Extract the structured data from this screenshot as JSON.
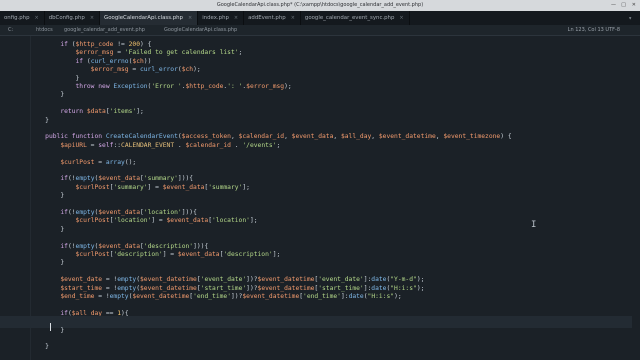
{
  "window_title": "GoogleCalendarApi.class.php* (C:\\xampp\\htdocs\\google_calendar_add_event.php)",
  "tabs": [
    {
      "label": "onfig.php",
      "active": false
    },
    {
      "label": "dbConfig.php",
      "active": false
    },
    {
      "label": "GoogleCalendarApi.class.php",
      "active": true
    },
    {
      "label": "index.php",
      "active": false
    },
    {
      "label": "addEvent.php",
      "active": false
    },
    {
      "label": "google_calendar_event_sync.php",
      "active": false
    }
  ],
  "breadcrumbs": [
    "C:",
    "htdocs",
    "google_calendar_add_event.php",
    "GoogleCalendarApi.class.php"
  ],
  "status": "Ln 123, Col 13   UTF-8",
  "code_lines": [
    [
      {
        "t": "        "
      },
      {
        "t": "if",
        "c": "kw"
      },
      {
        "t": " ("
      },
      {
        "t": "$http_code",
        "c": "var"
      },
      {
        "t": " != "
      },
      {
        "t": "200",
        "c": "num"
      },
      {
        "t": ") {"
      }
    ],
    [
      {
        "t": "            "
      },
      {
        "t": "$error_msg",
        "c": "var"
      },
      {
        "t": " = "
      },
      {
        "t": "'Failed to get calendars list'",
        "c": "str"
      },
      {
        "t": ";"
      }
    ],
    [
      {
        "t": "            "
      },
      {
        "t": "if",
        "c": "kw"
      },
      {
        "t": " ("
      },
      {
        "t": "curl_errno",
        "c": "fn"
      },
      {
        "t": "("
      },
      {
        "t": "$ch",
        "c": "var"
      },
      {
        "t": "))"
      }
    ],
    [
      {
        "t": "                "
      },
      {
        "t": "$error_msg",
        "c": "var"
      },
      {
        "t": " = "
      },
      {
        "t": "curl_error",
        "c": "fn"
      },
      {
        "t": "("
      },
      {
        "t": "$ch",
        "c": "var"
      },
      {
        "t": ");"
      }
    ],
    [
      {
        "t": "            "
      },
      {
        "t": "}"
      }
    ],
    [
      {
        "t": "            "
      },
      {
        "t": "throw new",
        "c": "kw"
      },
      {
        "t": " "
      },
      {
        "t": "Exception",
        "c": "fn"
      },
      {
        "t": "("
      },
      {
        "t": "'Error '",
        "c": "str"
      },
      {
        "t": "."
      },
      {
        "t": "$http_code",
        "c": "var"
      },
      {
        "t": "."
      },
      {
        "t": "': '",
        "c": "str"
      },
      {
        "t": "."
      },
      {
        "t": "$error_msg",
        "c": "var"
      },
      {
        "t": ");"
      }
    ],
    [
      {
        "t": "        "
      },
      {
        "t": "}"
      }
    ],
    [
      {
        "t": ""
      }
    ],
    [
      {
        "t": "        "
      },
      {
        "t": "return",
        "c": "kw"
      },
      {
        "t": " "
      },
      {
        "t": "$data",
        "c": "var"
      },
      {
        "t": "["
      },
      {
        "t": "'items'",
        "c": "str"
      },
      {
        "t": "];"
      }
    ],
    [
      {
        "t": "    "
      },
      {
        "t": "}"
      }
    ],
    [
      {
        "t": ""
      }
    ],
    [
      {
        "t": "    "
      },
      {
        "t": "public function",
        "c": "kw"
      },
      {
        "t": " "
      },
      {
        "t": "CreateCalendarEvent",
        "c": "fn"
      },
      {
        "t": "("
      },
      {
        "t": "$access_token",
        "c": "var"
      },
      {
        "t": ", "
      },
      {
        "t": "$calendar_id",
        "c": "var"
      },
      {
        "t": ", "
      },
      {
        "t": "$event_data",
        "c": "var"
      },
      {
        "t": ", "
      },
      {
        "t": "$all_day",
        "c": "var"
      },
      {
        "t": ", "
      },
      {
        "t": "$event_datetime",
        "c": "var"
      },
      {
        "t": ", "
      },
      {
        "t": "$event_timezone",
        "c": "var"
      },
      {
        "t": ") {"
      }
    ],
    [
      {
        "t": "        "
      },
      {
        "t": "$apiURL",
        "c": "var"
      },
      {
        "t": " = "
      },
      {
        "t": "self",
        "c": "kw"
      },
      {
        "t": "::"
      },
      {
        "t": "CALENDAR_EVENT",
        "c": "const"
      },
      {
        "t": " . "
      },
      {
        "t": "$calendar_id",
        "c": "var"
      },
      {
        "t": " . "
      },
      {
        "t": "'/events'",
        "c": "str"
      },
      {
        "t": ";"
      }
    ],
    [
      {
        "t": ""
      }
    ],
    [
      {
        "t": "        "
      },
      {
        "t": "$curlPost",
        "c": "var"
      },
      {
        "t": " = "
      },
      {
        "t": "array",
        "c": "fn"
      },
      {
        "t": "();"
      }
    ],
    [
      {
        "t": ""
      }
    ],
    [
      {
        "t": "        "
      },
      {
        "t": "if",
        "c": "kw"
      },
      {
        "t": "(!"
      },
      {
        "t": "empty",
        "c": "fn"
      },
      {
        "t": "("
      },
      {
        "t": "$event_data",
        "c": "var"
      },
      {
        "t": "["
      },
      {
        "t": "'summary'",
        "c": "str"
      },
      {
        "t": "])){"
      }
    ],
    [
      {
        "t": "            "
      },
      {
        "t": "$curlPost",
        "c": "var"
      },
      {
        "t": "["
      },
      {
        "t": "'summary'",
        "c": "str"
      },
      {
        "t": "] = "
      },
      {
        "t": "$event_data",
        "c": "var"
      },
      {
        "t": "["
      },
      {
        "t": "'summary'",
        "c": "str"
      },
      {
        "t": "];"
      }
    ],
    [
      {
        "t": "        "
      },
      {
        "t": "}"
      }
    ],
    [
      {
        "t": ""
      }
    ],
    [
      {
        "t": "        "
      },
      {
        "t": "if",
        "c": "kw"
      },
      {
        "t": "(!"
      },
      {
        "t": "empty",
        "c": "fn"
      },
      {
        "t": "("
      },
      {
        "t": "$event_data",
        "c": "var"
      },
      {
        "t": "["
      },
      {
        "t": "'location'",
        "c": "str"
      },
      {
        "t": "])){"
      }
    ],
    [
      {
        "t": "            "
      },
      {
        "t": "$curlPost",
        "c": "var"
      },
      {
        "t": "["
      },
      {
        "t": "'location'",
        "c": "str"
      },
      {
        "t": "] = "
      },
      {
        "t": "$event_data",
        "c": "var"
      },
      {
        "t": "["
      },
      {
        "t": "'location'",
        "c": "str"
      },
      {
        "t": "];"
      }
    ],
    [
      {
        "t": "        "
      },
      {
        "t": "}"
      }
    ],
    [
      {
        "t": ""
      }
    ],
    [
      {
        "t": "        "
      },
      {
        "t": "if",
        "c": "kw"
      },
      {
        "t": "(!"
      },
      {
        "t": "empty",
        "c": "fn"
      },
      {
        "t": "("
      },
      {
        "t": "$event_data",
        "c": "var"
      },
      {
        "t": "["
      },
      {
        "t": "'description'",
        "c": "str"
      },
      {
        "t": "])){"
      }
    ],
    [
      {
        "t": "            "
      },
      {
        "t": "$curlPost",
        "c": "var"
      },
      {
        "t": "["
      },
      {
        "t": "'description'",
        "c": "str"
      },
      {
        "t": "] = "
      },
      {
        "t": "$event_data",
        "c": "var"
      },
      {
        "t": "["
      },
      {
        "t": "'description'",
        "c": "str"
      },
      {
        "t": "];"
      }
    ],
    [
      {
        "t": "        "
      },
      {
        "t": "}"
      }
    ],
    [
      {
        "t": ""
      }
    ],
    [
      {
        "t": "        "
      },
      {
        "t": "$event_date",
        "c": "var"
      },
      {
        "t": " = !"
      },
      {
        "t": "empty",
        "c": "fn"
      },
      {
        "t": "("
      },
      {
        "t": "$event_datetime",
        "c": "var"
      },
      {
        "t": "["
      },
      {
        "t": "'event_date'",
        "c": "str"
      },
      {
        "t": "])?"
      },
      {
        "t": "$event_datetime",
        "c": "var"
      },
      {
        "t": "["
      },
      {
        "t": "'event_date'",
        "c": "str"
      },
      {
        "t": "]:"
      },
      {
        "t": "date",
        "c": "fn"
      },
      {
        "t": "("
      },
      {
        "t": "\"Y-m-d\"",
        "c": "str"
      },
      {
        "t": ");"
      }
    ],
    [
      {
        "t": "        "
      },
      {
        "t": "$start_time",
        "c": "var"
      },
      {
        "t": " = !"
      },
      {
        "t": "empty",
        "c": "fn"
      },
      {
        "t": "("
      },
      {
        "t": "$event_datetime",
        "c": "var"
      },
      {
        "t": "["
      },
      {
        "t": "'start_time'",
        "c": "str"
      },
      {
        "t": "])?"
      },
      {
        "t": "$event_datetime",
        "c": "var"
      },
      {
        "t": "["
      },
      {
        "t": "'start_time'",
        "c": "str"
      },
      {
        "t": "]:"
      },
      {
        "t": "date",
        "c": "fn"
      },
      {
        "t": "("
      },
      {
        "t": "\"H:i:s\"",
        "c": "str"
      },
      {
        "t": ");"
      }
    ],
    [
      {
        "t": "        "
      },
      {
        "t": "$end_time",
        "c": "var"
      },
      {
        "t": " = !"
      },
      {
        "t": "empty",
        "c": "fn"
      },
      {
        "t": "("
      },
      {
        "t": "$event_datetime",
        "c": "var"
      },
      {
        "t": "["
      },
      {
        "t": "'end_time'",
        "c": "str"
      },
      {
        "t": "])?"
      },
      {
        "t": "$event_datetime",
        "c": "var"
      },
      {
        "t": "["
      },
      {
        "t": "'end_time'",
        "c": "str"
      },
      {
        "t": "]:"
      },
      {
        "t": "date",
        "c": "fn"
      },
      {
        "t": "("
      },
      {
        "t": "\"H:i:s\"",
        "c": "str"
      },
      {
        "t": ");"
      }
    ],
    [
      {
        "t": ""
      }
    ],
    [
      {
        "t": "        "
      },
      {
        "t": "if",
        "c": "kw"
      },
      {
        "t": "("
      },
      {
        "t": "$all_day",
        "c": "var"
      },
      {
        "t": " == "
      },
      {
        "t": "1",
        "c": "num"
      },
      {
        "t": "){"
      }
    ],
    [
      {
        "t": "            "
      }
    ],
    [
      {
        "t": "        "
      },
      {
        "t": "}"
      }
    ],
    [
      {
        "t": ""
      }
    ],
    [
      {
        "t": "    "
      },
      {
        "t": "}"
      }
    ]
  ],
  "current_line_index": 33,
  "colors": {
    "keyword": "#d3a8e7",
    "variable": "#f39b6d",
    "string": "#b5d98a",
    "function": "#7fb8e8",
    "number": "#f3c36d",
    "background": "#1b2127"
  }
}
